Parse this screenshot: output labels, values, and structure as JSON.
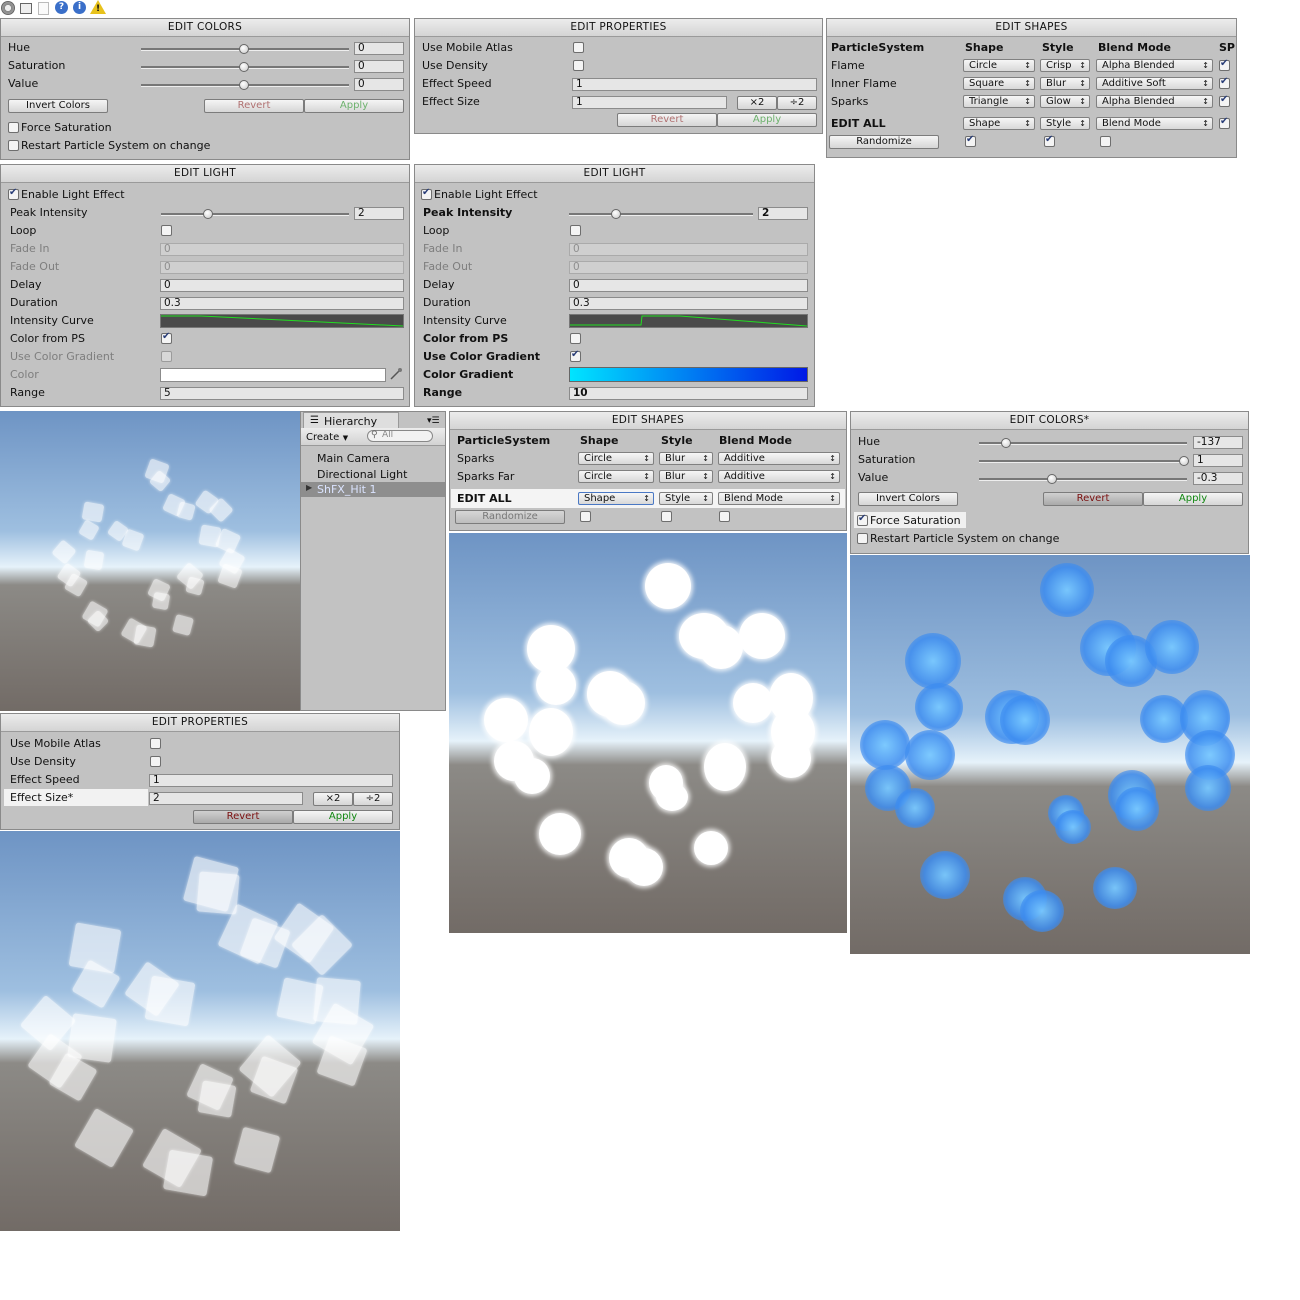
{
  "toolbar": {
    "icons": [
      "gear-icon",
      "window-icon",
      "doc-icon",
      "help-icon",
      "info-icon",
      "warning-icon"
    ]
  },
  "edit_colors_1": {
    "title": "EDIT COLORS",
    "rows": [
      {
        "label": "Hue",
        "value": "0",
        "slider_fraction": 0.5
      },
      {
        "label": "Saturation",
        "value": "0",
        "slider_fraction": 0.5
      },
      {
        "label": "Value",
        "value": "0",
        "slider_fraction": 0.5
      }
    ],
    "invert_label": "Invert Colors",
    "revert_label": "Revert",
    "apply_label": "Apply",
    "force_saturation": {
      "label": "Force Saturation",
      "checked": false
    },
    "restart": {
      "label": "Restart Particle System on change",
      "checked": false
    }
  },
  "edit_properties_1": {
    "title": "EDIT PROPERTIES",
    "use_mobile_atlas": "Use Mobile Atlas",
    "use_density": "Use Density",
    "effect_speed_label": "Effect Speed",
    "effect_speed": "1",
    "effect_size_label": "Effect Size",
    "effect_size": "1",
    "x2_label": "×2",
    "div2_label": "÷2",
    "revert_label": "Revert",
    "apply_label": "Apply"
  },
  "edit_shapes_1": {
    "title": "EDIT SHAPES",
    "headers": {
      "system": "ParticleSystem",
      "shape": "Shape",
      "style": "Style",
      "blend": "Blend Mode",
      "sp": "SP"
    },
    "rows": [
      {
        "name": "Flame",
        "shape": "Circle",
        "style": "Crisp",
        "blend": "Alpha Blended",
        "checked": true
      },
      {
        "name": "Inner Flame",
        "shape": "Square",
        "style": "Blur",
        "blend": "Additive Soft",
        "checked": true
      },
      {
        "name": "Sparks",
        "shape": "Triangle",
        "style": "Glow",
        "blend": "Alpha Blended",
        "checked": true
      }
    ],
    "edit_all": {
      "label": "EDIT ALL",
      "shape": "Shape",
      "style": "Style",
      "blend": "Blend Mode"
    },
    "randomize_label": "Randomize"
  },
  "edit_light_1": {
    "title": "EDIT LIGHT",
    "enable_label": "Enable Light Effect",
    "peak_label": "Peak Intensity",
    "peak_value": "2",
    "peak_fraction": 0.25,
    "loop_label": "Loop",
    "fade_in_label": "Fade In",
    "fade_in": "0",
    "fade_out_label": "Fade Out",
    "fade_out": "0",
    "delay_label": "Delay",
    "delay": "0",
    "duration_label": "Duration",
    "duration": "0.3",
    "curve_label": "Intensity Curve",
    "color_ps_label": "Color from PS",
    "use_grad_label": "Use Color Gradient",
    "color_label": "Color",
    "range_label": "Range",
    "range": "5"
  },
  "edit_light_2": {
    "title": "EDIT LIGHT",
    "enable_label": "Enable Light Effect",
    "peak_label": "Peak Intensity",
    "peak_value": "2",
    "peak_fraction": 0.25,
    "loop_label": "Loop",
    "fade_in_label": "Fade In",
    "fade_in": "0",
    "fade_out_label": "Fade Out",
    "fade_out": "0",
    "delay_label": "Delay",
    "delay": "0",
    "duration_label": "Duration",
    "duration": "0.3",
    "curve_label": "Intensity Curve",
    "color_ps_label": "Color from PS",
    "use_grad_label": "Use Color Gradient",
    "grad_label": "Color Gradient",
    "range_label": "Range",
    "range": "10"
  },
  "hierarchy": {
    "tab_label": "Hierarchy",
    "create_label": "Create",
    "search_placeholder": "All",
    "items": [
      "Main Camera",
      "Directional Light",
      "ShFX_Hit 1"
    ],
    "selected_index": 2
  },
  "edit_shapes_2": {
    "title": "EDIT SHAPES",
    "headers": {
      "system": "ParticleSystem",
      "shape": "Shape",
      "style": "Style",
      "blend": "Blend Mode"
    },
    "rows": [
      {
        "name": "Sparks",
        "shape": "Circle",
        "style": "Blur",
        "blend": "Additive"
      },
      {
        "name": "Sparks Far",
        "shape": "Circle",
        "style": "Blur",
        "blend": "Additive"
      }
    ],
    "edit_all": {
      "label": "EDIT ALL",
      "shape": "Shape",
      "style": "Style",
      "blend": "Blend Mode"
    },
    "randomize_label": "Randomize"
  },
  "edit_colors_2": {
    "title": "EDIT COLORS*",
    "rows": [
      {
        "label": "Hue",
        "value": "-137",
        "slider_fraction": 0.13
      },
      {
        "label": "Saturation",
        "value": "1",
        "slider_fraction": 1.0
      },
      {
        "label": "Value",
        "value": "-0.3",
        "slider_fraction": 0.35
      }
    ],
    "invert_label": "Invert Colors",
    "revert_label": "Revert",
    "apply_label": "Apply",
    "force_saturation": {
      "label": "Force Saturation",
      "checked": true
    },
    "restart": {
      "label": "Restart Particle System on change",
      "checked": false
    }
  },
  "edit_properties_2": {
    "title": "EDIT PROPERTIES",
    "use_mobile_atlas": "Use Mobile Atlas",
    "use_density": "Use Density",
    "effect_speed_label": "Effect Speed",
    "effect_speed": "1",
    "effect_size_label": "Effect Size*",
    "effect_size": "2",
    "x2_label": "×2",
    "div2_label": "÷2",
    "revert_label": "Revert",
    "apply_label": "Apply"
  },
  "colors": {
    "panel": "#c2c2c2",
    "gradient_start": "#00e5ff",
    "gradient_end": "#0019e6",
    "curve_line": "#22dd22"
  }
}
